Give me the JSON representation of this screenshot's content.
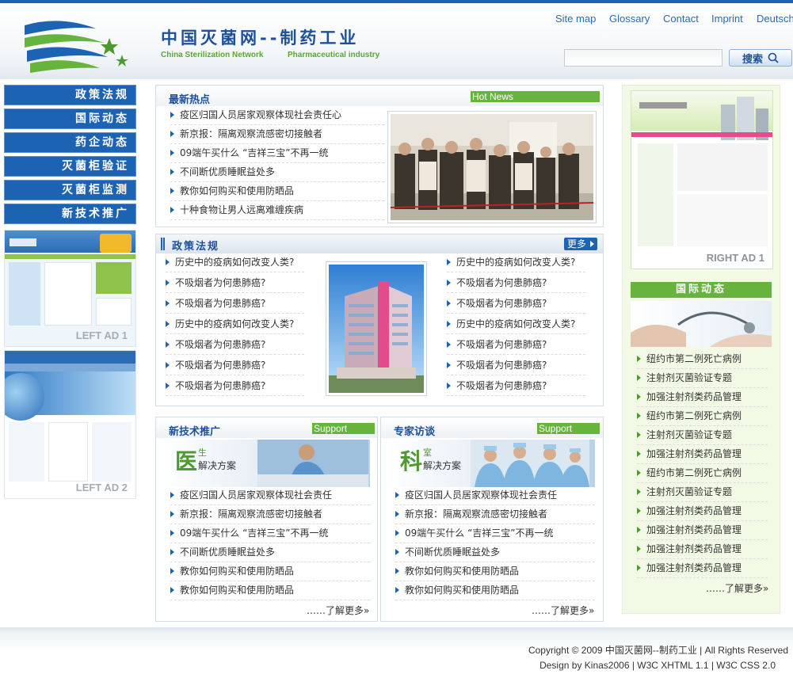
{
  "header": {
    "logo_cn": "中国灭菌网--制药工业",
    "logo_en_left": "China Sterilization Network",
    "logo_en_right": "Pharmaceutical industry",
    "links": [
      "Site map",
      "Glossary",
      "Contact",
      "Imprint",
      "Deutsch"
    ],
    "search_placeholder": "",
    "search_button": "搜索"
  },
  "nav": [
    "政策法规",
    "国际动态",
    "药企动态",
    "灭菌柜验证",
    "灭菌柜监测",
    "新技术推广"
  ],
  "ads": {
    "left1": "LEFT AD 1",
    "left2": "LEFT AD 2",
    "right1": "RIGHT AD  1"
  },
  "hot": {
    "title": "最新热点",
    "badge": "Hot News",
    "items": [
      "疫区归国人员居家观察体现社会责任心",
      "新京报：隔离观察流感密切接触者",
      "09端午买什么 “吉祥三宝”不再一统",
      "不间断优质睡眠益处多",
      "教你如何购买和使用防晒品",
      "十种食物让男人远离难缠疾病"
    ]
  },
  "policy": {
    "title": "政策法规",
    "more": "更多",
    "left": [
      "历史中的疫病如何改变人类?",
      "不吸烟者为何患肺癌?",
      "不吸烟者为何患肺癌?",
      "历史中的疫病如何改变人类?",
      "不吸烟者为何患肺癌?",
      "不吸烟者为何患肺癌?",
      "不吸烟者为何患肺癌?"
    ],
    "right": [
      "历史中的疫病如何改变人类?",
      "不吸烟者为何患肺癌?",
      "不吸烟者为何患肺癌?",
      "历史中的疫病如何改变人类?",
      "不吸烟者为何患肺癌?",
      "不吸烟者为何患肺癌?",
      "不吸烟者为何患肺癌?"
    ]
  },
  "tech": {
    "title": "新技术推广",
    "badge": "Support",
    "banner_big": "医",
    "banner_small": "生",
    "banner_text": "解决方案",
    "items": [
      "疫区归国人员居家观察体现社会责任",
      "新京报：隔离观察流感密切接触者",
      "09端午买什么 “吉祥三宝”不再一统",
      "不间断优质睡眠益处多",
      "教你如何购买和使用防晒品",
      "教你如何购买和使用防晒品"
    ],
    "more": "……了解更多»"
  },
  "expert": {
    "title": "专家访谈",
    "badge": "Support",
    "banner_big": "科",
    "banner_small": "室",
    "banner_text": "解决方案",
    "items": [
      "疫区归国人员居家观察体现社会责任",
      "新京报：隔离观察流感密切接触者",
      "09端午买什么 “吉祥三宝”不再一统",
      "不间断优质睡眠益处多",
      "教你如何购买和使用防晒品",
      "教你如何购买和使用防晒品"
    ],
    "more": "……了解更多»"
  },
  "intl": {
    "title": "国际动态",
    "items": [
      "纽约市第二例死亡病例",
      "注射剂灭菌验证专题",
      "加强注射剂类药品管理",
      "纽约市第二例死亡病例",
      "注射剂灭菌验证专题",
      "加强注射剂类药品管理",
      "纽约市第二例死亡病例",
      "注射剂灭菌验证专题",
      "加强注射剂类药品管理",
      "加强注射剂类药品管理",
      "加强注射剂类药品管理",
      "加强注射剂类药品管理"
    ],
    "more": "……了解更多»"
  },
  "footer": {
    "copyright": "Copyright © 2009 中国灭菌网--制药工业  | All Rights Reserved",
    "design": "Design by Kinas2006 | W3C XHTML 1.1 | W3C CSS 2.0"
  },
  "colors": {
    "brand_blue": "#1d63b4",
    "green": "#66b43e",
    "right_bg": "#f2f9e4"
  }
}
